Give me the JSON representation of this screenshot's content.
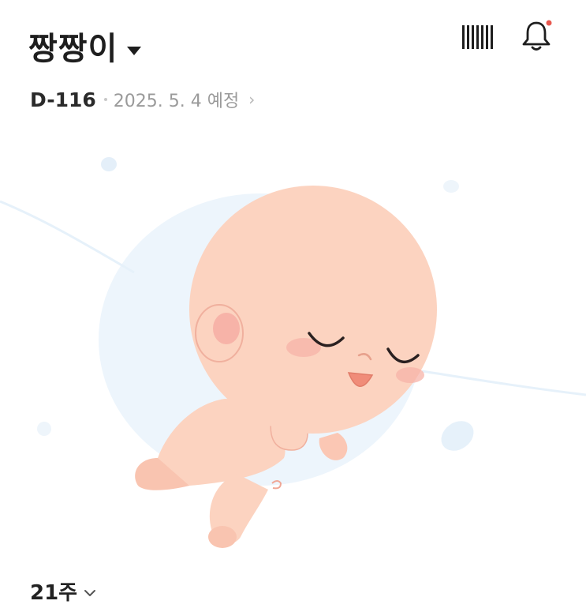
{
  "header": {
    "baby_name": "짱짱이",
    "dday": "D-116",
    "due_date": "2025. 5. 4 예정"
  },
  "icons": {
    "dropdown": "caret-down-icon",
    "barcode": "barcode-icon",
    "notifications": "bell-icon",
    "notification_badge_color": "#e8584f",
    "due_date_chevron": "chevron-right-icon",
    "week_chevron": "chevron-down-icon"
  },
  "week_selector": {
    "label": "21주"
  },
  "colors": {
    "skin": "#fcd3c0",
    "background_blob": "#edf5fc",
    "cheek": "#f7b3a8"
  }
}
